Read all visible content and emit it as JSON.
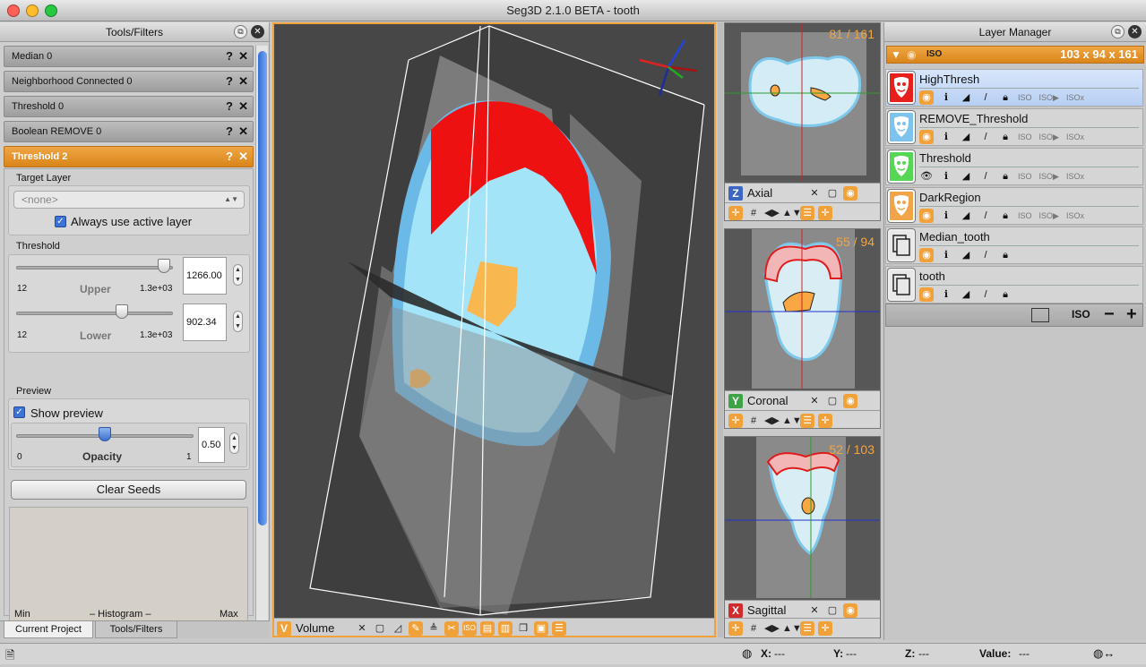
{
  "window": {
    "title": "Seg3D 2.1.0 BETA - tooth"
  },
  "tools_panel": {
    "title": "Tools/Filters",
    "tool_rows": [
      "Median 0",
      "Neighborhood Connected 0",
      "Threshold 0",
      "Boolean REMOVE 0"
    ],
    "active_tool": "Threshold 2",
    "help_glyph": "?",
    "close_glyph": "✕",
    "target_layer_label": "Target Layer",
    "target_layer_value": "<none>",
    "always_active_label": "Always use active layer",
    "threshold_label": "Threshold",
    "upper": {
      "value": "1266.00",
      "min": "12",
      "max": "1.3e+03",
      "label": "Upper",
      "fraction": 0.98
    },
    "lower": {
      "value": "902.34",
      "min": "12",
      "max": "1.3e+03",
      "label": "Lower",
      "fraction": 0.69
    },
    "preview_label": "Preview",
    "show_preview_label": "Show preview",
    "opacity": {
      "value": "0.50",
      "min": "0",
      "max": "1",
      "label": "Opacity",
      "fraction": 0.5
    },
    "clear_seeds": "Clear Seeds",
    "histogram": {
      "min": "Min",
      "label": "– Histogram –",
      "max": "Max"
    },
    "tabs": [
      "Current Project",
      "Tools/Filters"
    ]
  },
  "volume_view": {
    "label": "Volume",
    "badge": "V",
    "badge_color": "#f0a13a"
  },
  "slice_views": [
    {
      "badge": "Z",
      "label": "Axial",
      "slice": "81 / 161",
      "badge_color": "#3b66c4"
    },
    {
      "badge": "Y",
      "label": "Coronal",
      "slice": "55 / 94",
      "badge_color": "#3da346"
    },
    {
      "badge": "X",
      "label": "Sagittal",
      "slice": "52 / 103",
      "badge_color": "#d12b2b"
    }
  ],
  "layer_manager": {
    "title": "Layer Manager",
    "group_iso": "ISO",
    "group_dims": "103 x 94 x 161",
    "iso_label": "ISO",
    "layers": [
      {
        "name": "HighThresh",
        "color": "#e8201c",
        "type": "mask",
        "selected": true
      },
      {
        "name": "REMOVE_Threshold",
        "color": "#7cc3ee",
        "type": "mask",
        "selected": false
      },
      {
        "name": "Threshold",
        "color": "#55d655",
        "type": "mask",
        "selected": false
      },
      {
        "name": "DarkRegion",
        "color": "#f2a449",
        "type": "mask",
        "selected": false
      },
      {
        "name": "Median_tooth",
        "color": "#d5d5d5",
        "type": "data",
        "selected": false
      },
      {
        "name": "tooth",
        "color": "#d5d5d5",
        "type": "data",
        "selected": false
      }
    ],
    "add_glyph": "+",
    "remove_glyph": "−"
  },
  "status": {
    "x_label": "X:",
    "x_value": "---",
    "y_label": "Y:",
    "y_value": "---",
    "z_label": "Z:",
    "z_value": "---",
    "value_label": "Value:",
    "value_value": "---"
  }
}
